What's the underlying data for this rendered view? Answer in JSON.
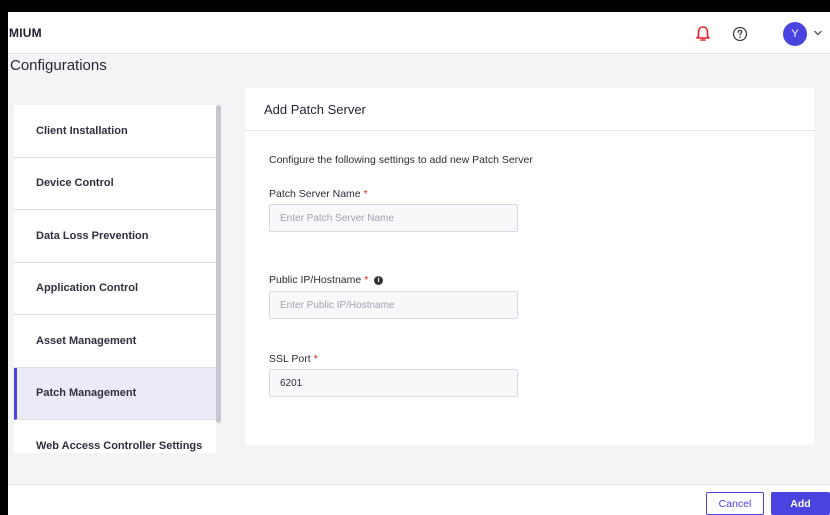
{
  "app": {
    "brand": "MIUM"
  },
  "header": {
    "avatar_initial": "Y"
  },
  "page": {
    "title": "Configurations"
  },
  "sidebar": {
    "items": [
      {
        "label": "Client Installation"
      },
      {
        "label": "Device Control"
      },
      {
        "label": "Data Loss Prevention"
      },
      {
        "label": "Application Control"
      },
      {
        "label": "Asset Management"
      },
      {
        "label": "Patch Management",
        "active": true
      },
      {
        "label": "Web Access Controller Settings"
      }
    ]
  },
  "form": {
    "title": "Add Patch Server",
    "description": "Configure the following settings to add new Patch Server",
    "required_marker": "*",
    "fields": [
      {
        "label": "Patch Server Name",
        "placeholder": "Enter Patch Server Name",
        "value": ""
      },
      {
        "label": "Public IP/Hostname",
        "placeholder": "Enter Public IP/Hostname",
        "value": ""
      },
      {
        "label": "SSL Port",
        "placeholder": "",
        "value": "6201"
      }
    ],
    "info_glyph": "i"
  },
  "actions": {
    "cancel_label": "Cancel",
    "add_label": "Add"
  },
  "colors": {
    "accent": "#4a43e0",
    "notification": "#e02424",
    "required": "#e02424",
    "active_item_bg": "#ebeaf9"
  },
  "icons": {
    "notifications": "bell-icon",
    "help": "help-circle-icon",
    "caret": "chevron-down-icon",
    "info": "info-icon"
  }
}
